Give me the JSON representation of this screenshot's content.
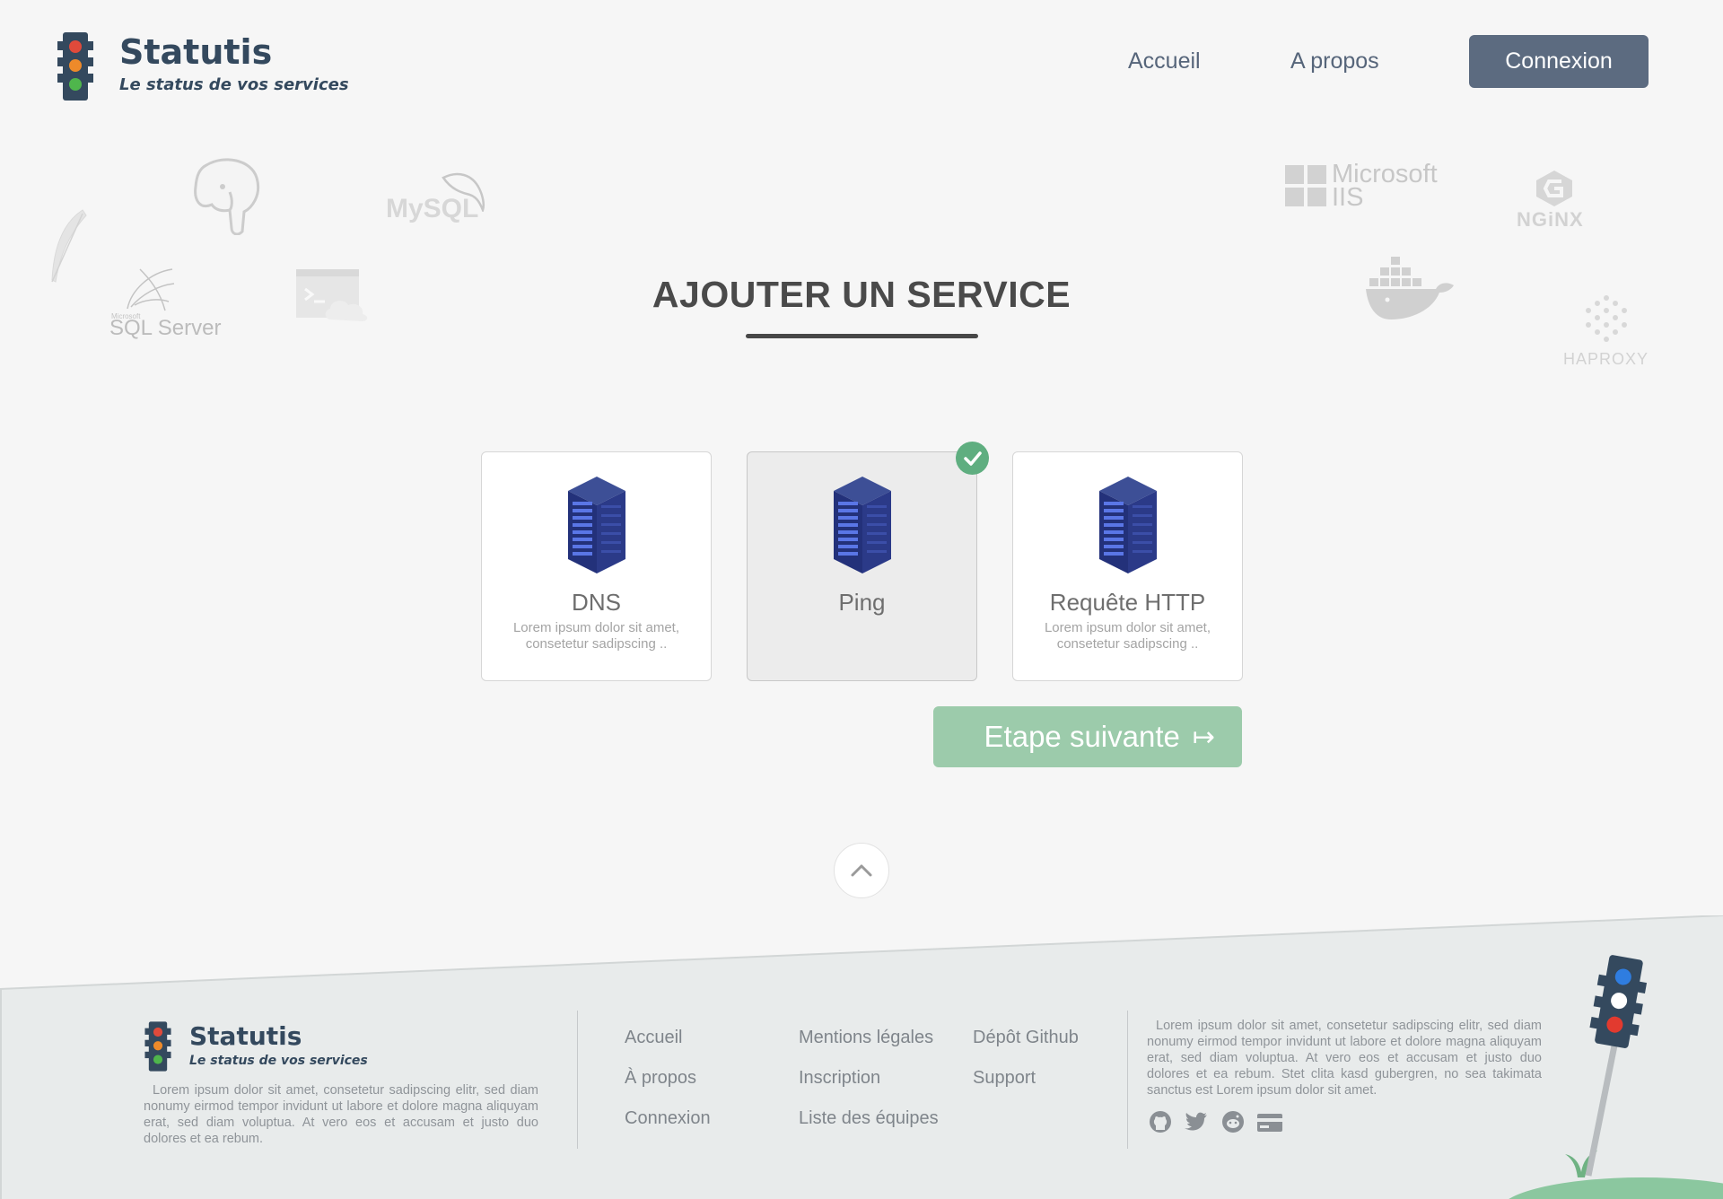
{
  "header": {
    "brand_name": "Statutis",
    "brand_tagline": "Le status de vos services",
    "nav": {
      "home": "Accueil",
      "about": "A propos",
      "login": "Connexion"
    }
  },
  "background_logos": {
    "mysql": "MySQL",
    "sqlserver_small": "Microsoft",
    "sqlserver": "SQL Server",
    "microsoft": "Microsoft",
    "iis": "IIS",
    "nginx": "NGiNX",
    "haproxy": "HAPROXY"
  },
  "main": {
    "title": "AJOUTER UN SERVICE",
    "cards": [
      {
        "title": "DNS",
        "desc": "Lorem ipsum dolor sit amet, consetetur sadipscing ..",
        "selected": false
      },
      {
        "title": "Ping",
        "desc": "",
        "selected": true
      },
      {
        "title": "Requête HTTP",
        "desc": "Lorem ipsum dolor sit amet, consetetur sadipscing ..",
        "selected": false
      }
    ],
    "next_label": "Etape suivante",
    "next_arrow": "↦"
  },
  "footer": {
    "brand_name": "Statutis",
    "brand_tagline": "Le status de vos services",
    "about_text": "Lorem ipsum dolor sit amet, consetetur sadipscing elitr, sed diam nonumy eirmod tempor invidunt ut labore et dolore magna aliquyam erat, sed diam voluptua. At vero eos et accusam et justo duo dolores et ea rebum.",
    "links_col1": [
      "Accueil",
      "À propos",
      "Connexion"
    ],
    "links_col2": [
      "Mentions légales",
      "Inscription",
      "Liste des équipes"
    ],
    "links_col3": [
      "Dépôt Github",
      "Support"
    ],
    "right_text": "Lorem ipsum dolor sit amet, consetetur sadipscing elitr, sed diam nonumy eirmod tempor invidunt ut labore et dolore magna aliquyam erat, sed diam voluptua. At vero eos et accusam et justo duo dolores et ea rebum. Stet clita kasd gubergren, no sea takimata sanctus est Lorem ipsum dolor sit amet.",
    "social_icons": [
      "github-icon",
      "twitter-icon",
      "reddit-icon",
      "credit-card-icon"
    ]
  },
  "colors": {
    "primary": "#5c6b80",
    "success": "#5fae80",
    "next_button": "#9ccbab",
    "footer_bg": "#e8ebeb",
    "brand": "#34495e"
  }
}
